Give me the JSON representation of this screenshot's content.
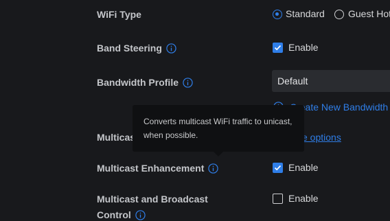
{
  "wifi_type": {
    "label": "WiFi Type",
    "options": [
      "Standard",
      "Guest Hot"
    ],
    "selected": "Standard"
  },
  "band_steering": {
    "label": "Band Steering",
    "checkbox_label": "Enable",
    "checked": true
  },
  "bandwidth_profile": {
    "label": "Bandwidth Profile",
    "value": "Default",
    "create_link": "Create New Bandwidth"
  },
  "multicast_partial": {
    "label": "Multicas",
    "link_fragment": "e options"
  },
  "tooltip": {
    "text": "Converts multicast WiFi traffic to unicast, when possible."
  },
  "multicast_enhancement": {
    "label": "Multicast Enhancement",
    "checkbox_label": "Enable",
    "checked": true
  },
  "multicast_broadcast": {
    "label_line1": "Multicast and Broadcast",
    "label_line2": "Control",
    "checkbox_label": "Enable",
    "checked": false
  },
  "colors": {
    "accent": "#2f7ee8",
    "background": "#18191c"
  },
  "icons": {
    "info": "info-circle-icon",
    "check": "check-icon",
    "plus": "plus-circle-icon"
  }
}
